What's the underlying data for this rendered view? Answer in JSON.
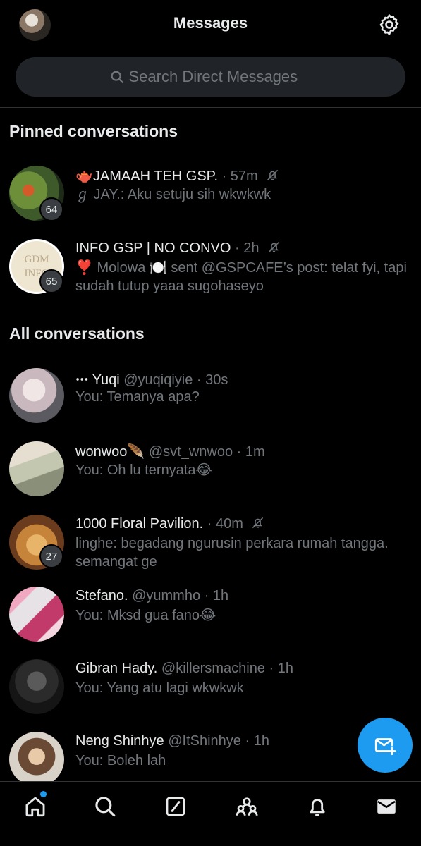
{
  "header": {
    "title": "Messages"
  },
  "search": {
    "placeholder": "Search Direct Messages"
  },
  "pinned": {
    "section_title": "Pinned conversations",
    "items": [
      {
        "emoji": "🫖",
        "name": "JAMAAH TEH GSP.",
        "time": "· 57m",
        "muted": true,
        "preview": "ℊ JAY.: Aku setuju sih wkwkwk",
        "badge": "64"
      },
      {
        "name": "INFO GSP | NO CONVO",
        "time": "· 2h",
        "muted": true,
        "preview": "❣️ Molowa 🍽️ sent @GSPCAFE’s post: telat fyi, tapi sudah tutup yaaa sugohaseyo",
        "badge": "65",
        "avatar_text": "GDM INFO"
      }
    ]
  },
  "all": {
    "section_title": "All conversations",
    "items": [
      {
        "name": "ꞏꞏꞏ Yuqi",
        "handle": "@yuqiqiyie",
        "time": "· 30s",
        "preview": "You: Temanya apa?"
      },
      {
        "name": "wonwoo🪶",
        "handle": "@svt_wnwoo",
        "time": "· 1m",
        "preview": "You: Oh lu ternyata😂"
      },
      {
        "name": "1000 Floral Pavilion.",
        "time": "· 40m",
        "muted": true,
        "preview": "linghe: begadang ngurusin perkara rumah tangga. semangat ge",
        "badge": "27"
      },
      {
        "name": "Stefano.",
        "handle": "@yummho",
        "time": "· 1h",
        "preview": "You: Mksd gua fano😂"
      },
      {
        "name": "Gibran Hady.",
        "handle": "@killersmachine",
        "time": "· 1h",
        "preview": "You: Yang atu lagi wkwkwk"
      },
      {
        "name": "Neng Shinhye",
        "handle": "@ItShinhye",
        "time": "· 1h",
        "preview": "You: Boleh lah"
      }
    ]
  },
  "icons": {
    "top": [
      "profile-avatar",
      "gear-icon"
    ],
    "search": "search-icon",
    "mute": "bell-off-icon",
    "fab": "new-message-icon",
    "bottom_nav": [
      "home-icon",
      "search-icon",
      "grok-icon",
      "communities-icon",
      "bell-icon",
      "mail-icon"
    ]
  },
  "colors": {
    "accent": "#1d9bf0",
    "background": "#000000",
    "text": "#e7e9ea",
    "secondary": "#71767b",
    "badge": "#3a3d41"
  }
}
